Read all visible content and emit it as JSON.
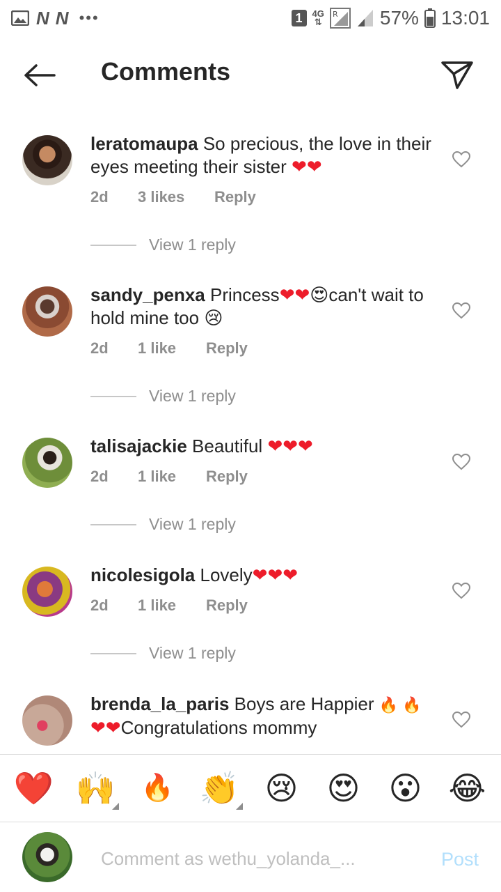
{
  "status_bar": {
    "sim_badge": "1",
    "network": "4G",
    "battery": "57%",
    "time": "13:01"
  },
  "header": {
    "title": "Comments"
  },
  "comments": [
    {
      "username": "leratomaupa",
      "text": "So precious,  the love in their eyes meeting their sister",
      "emoji": "❤❤",
      "time": "2d",
      "likes": "3 likes",
      "reply": "Reply",
      "view_replies": "View 1 reply"
    },
    {
      "username": "sandy_penxa",
      "text_before": "Princess",
      "emoji_mid": "❤❤",
      "emoji_face": "😍",
      "text_after": "can't wait to hold mine too",
      "emoji_end": "😢",
      "time": "2d",
      "likes": "1 like",
      "reply": "Reply",
      "view_replies": "View 1 reply"
    },
    {
      "username": "talisajackie",
      "text": "Beautiful",
      "emoji": "❤❤❤",
      "time": "2d",
      "likes": "1 like",
      "reply": "Reply",
      "view_replies": "View 1 reply"
    },
    {
      "username": "nicolesigola",
      "text": "Lovely",
      "emoji": "❤❤❤",
      "time": "2d",
      "likes": "1 like",
      "reply": "Reply",
      "view_replies": "View 1 reply"
    },
    {
      "username": "brenda_la_paris",
      "text_before": "Boys are Happier",
      "emoji_fire": "🔥 🔥",
      "emoji_hearts": "❤❤",
      "text_after": "Congratulations mommy"
    }
  ],
  "emoji_bar": [
    "❤️",
    "🙌",
    "🔥",
    "👏",
    "😢",
    "😍",
    "😮",
    "😂"
  ],
  "comment_input": {
    "placeholder": "Comment as wethu_yolanda_...",
    "post_label": "Post"
  },
  "colors": {
    "text": "#262626",
    "meta": "#8e8e8e",
    "heart": "#ed1c2a",
    "post": "#b2dffc"
  }
}
